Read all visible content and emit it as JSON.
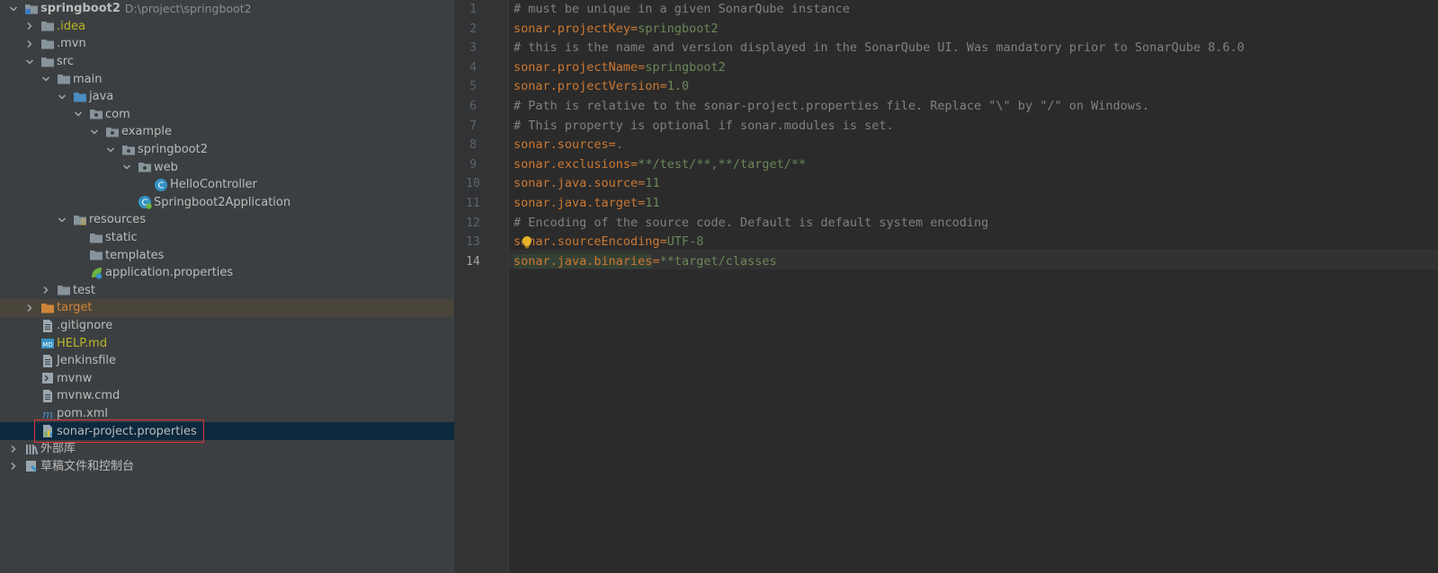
{
  "project_tree": {
    "rows": [
      {
        "label": "springboot2",
        "hint": "D:\\project\\springboot2"
      },
      {
        "label": ".idea"
      },
      {
        "label": ".mvn"
      },
      {
        "label": "src"
      },
      {
        "label": "main"
      },
      {
        "label": "java"
      },
      {
        "label": "com"
      },
      {
        "label": "example"
      },
      {
        "label": "springboot2"
      },
      {
        "label": "web"
      },
      {
        "label": "HelloController"
      },
      {
        "label": "Springboot2Application"
      },
      {
        "label": "resources"
      },
      {
        "label": "static"
      },
      {
        "label": "templates"
      },
      {
        "label": "application.properties"
      },
      {
        "label": "test"
      },
      {
        "label": "target"
      },
      {
        "label": ".gitignore"
      },
      {
        "label": "HELP.md"
      },
      {
        "label": "Jenkinsfile"
      },
      {
        "label": "mvnw"
      },
      {
        "label": "mvnw.cmd"
      },
      {
        "label": "pom.xml"
      },
      {
        "label": "sonar-project.properties"
      },
      {
        "label": "外部库"
      },
      {
        "label": "草稿文件和控制台"
      }
    ]
  },
  "editor": {
    "line_numbers": [
      "1",
      "2",
      "3",
      "4",
      "5",
      "6",
      "7",
      "8",
      "9",
      "10",
      "11",
      "12",
      "13",
      "14"
    ],
    "lines": [
      {
        "comment": "# must be unique in a given SonarQube instance"
      },
      {
        "key": "sonar.projectKey",
        "eq": "=",
        "value": "springboot2"
      },
      {
        "comment": "# this is the name and version displayed in the SonarQube UI. Was mandatory prior to SonarQube 8.6.0"
      },
      {
        "key": "sonar.projectName",
        "eq": "=",
        "value": "springboot2"
      },
      {
        "key": "sonar.projectVersion",
        "eq": "=",
        "value": "1.0"
      },
      {
        "comment": "# Path is relative to the sonar-project.properties file. Replace \"\\\" by \"/\" on Windows."
      },
      {
        "comment": "# This property is optional if sonar.modules is set."
      },
      {
        "key": "sonar.sources",
        "eq": "=",
        "value": "."
      },
      {
        "key": "sonar.exclusions",
        "eq": "=",
        "value": "**/test/**,**/target/**"
      },
      {
        "key": "sonar.java.source",
        "eq": "=",
        "value": "11"
      },
      {
        "key": "sonar.java.target",
        "eq": "=",
        "value": "11"
      },
      {
        "comment": "# Encoding of the source code. Default is default system encoding"
      },
      {
        "key": "sonar.sourceEncoding",
        "eq": "=",
        "value": "UTF-8"
      },
      {
        "key": "sonar.java.binaries",
        "eq": "=",
        "value": "**target/classes"
      }
    ],
    "current_line": "14"
  },
  "colors": {
    "sidebar_bg": "#3c3f41",
    "editor_bg": "#2b2b2b",
    "property_key": "#cc7832",
    "property_value": "#6a8759",
    "comment": "#808080",
    "selection": "#0d293e",
    "highlight_box": "#e0303a"
  }
}
